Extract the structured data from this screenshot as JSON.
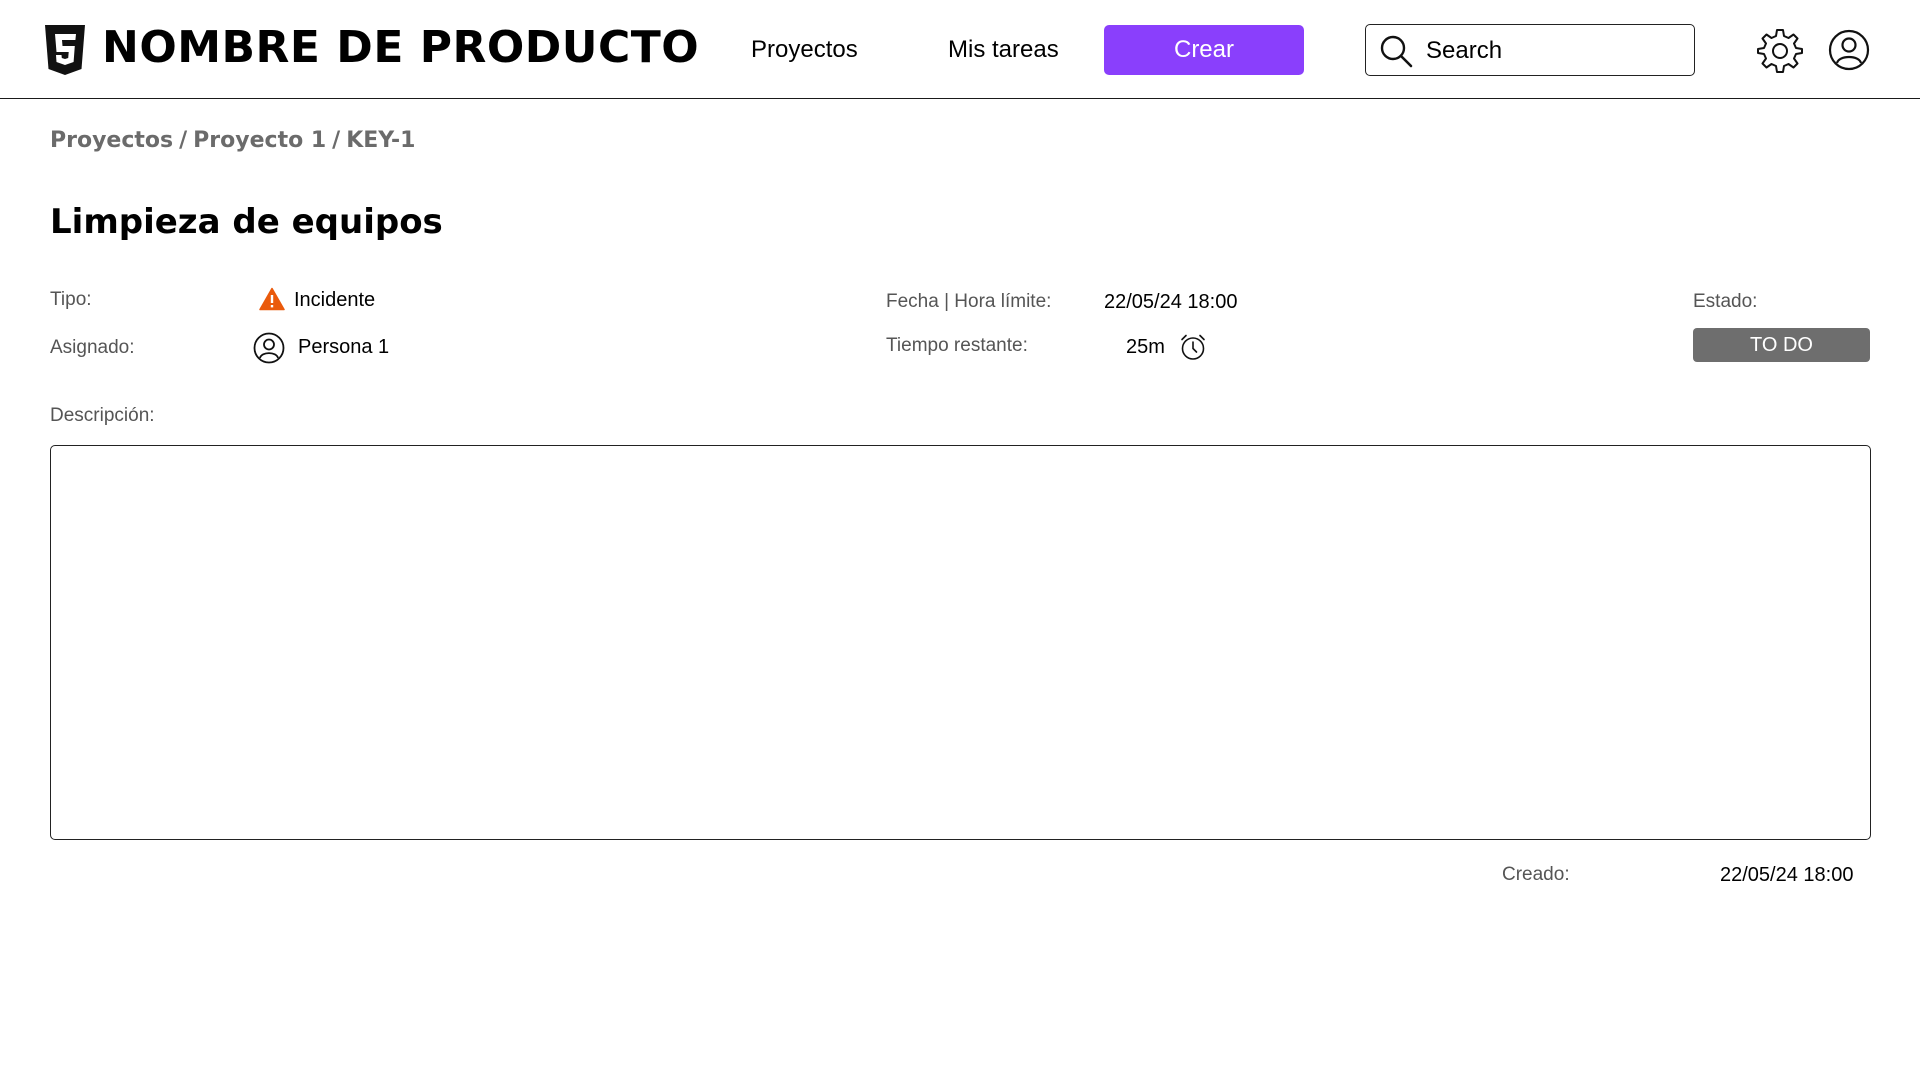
{
  "header": {
    "brand": "NOMBRE DE PRODUCTO",
    "nav": {
      "projects": "Proyectos",
      "my_tasks": "Mis tareas"
    },
    "create_label": "Crear",
    "search_placeholder": "Search",
    "accent_color": "#8a3ffc"
  },
  "breadcrumb": {
    "items": [
      "Proyectos",
      "Proyecto 1",
      "KEY-1"
    ],
    "separator": "/"
  },
  "task": {
    "title": "Limpieza de equipos",
    "type_label": "Tipo:",
    "type_value": "Incidente",
    "type_icon": "warning-icon",
    "assignee_label": "Asignado:",
    "assignee_value": "Persona 1",
    "deadline_label": "Fecha | Hora límite:",
    "deadline_value": "22/05/24  18:00",
    "remaining_label": "Tiempo restante:",
    "remaining_value": "25m",
    "status_label": "Estado:",
    "status_value": "TO DO",
    "status_color": "#6e6e6e",
    "description_label": "Descripción:",
    "description_value": "",
    "created_label": "Creado:",
    "created_value": "22/05/24  18:00"
  }
}
